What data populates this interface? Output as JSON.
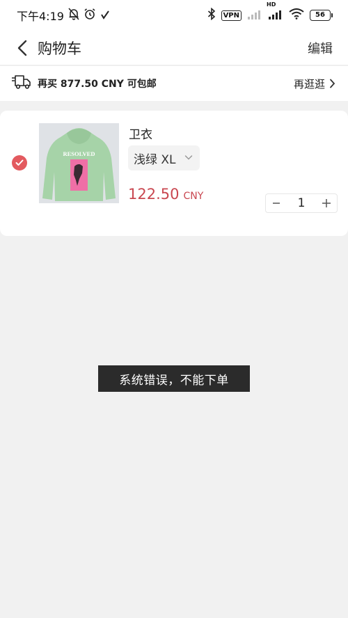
{
  "status_bar": {
    "time": "下午4:19",
    "vpn": "VPN",
    "network": "HD",
    "battery": "56"
  },
  "nav": {
    "title": "购物车",
    "edit": "编辑"
  },
  "shipping": {
    "text": "再买 877.50 CNY 可包邮",
    "more": "再逛逛"
  },
  "cart": {
    "items": [
      {
        "name": "卫衣",
        "variant": "浅绿 XL",
        "price": "122.50",
        "currency": "CNY",
        "quantity": "1",
        "selected": true,
        "image_text": "RESOLVED"
      }
    ]
  },
  "toast": {
    "message": "系统错误，不能下单"
  },
  "colors": {
    "accent": "#e35a5f",
    "price": "#c94750",
    "background": "#f1f1f1",
    "toast_bg": "#2b2b2b",
    "hoodie": "#a6d3a8",
    "print": "#ef6fa6"
  }
}
